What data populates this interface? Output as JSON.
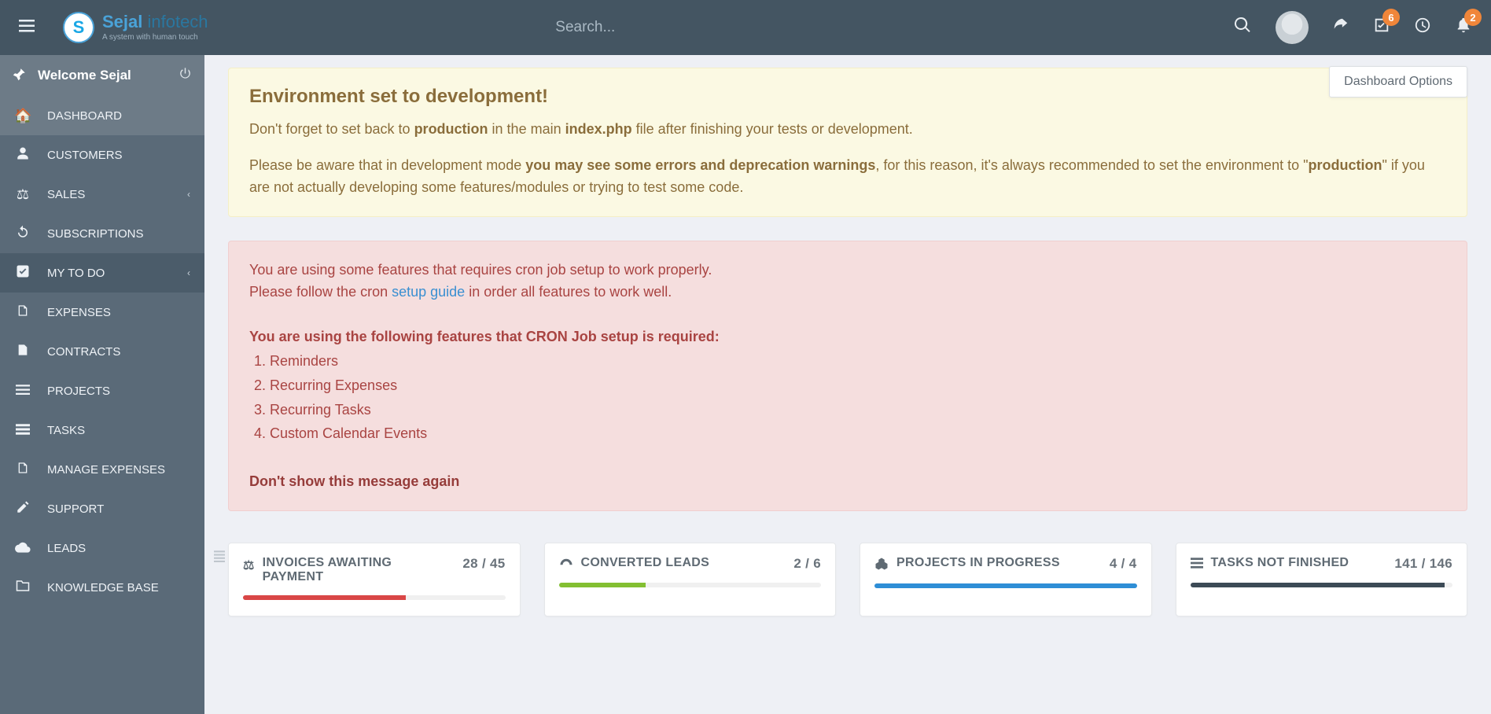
{
  "header": {
    "brand_main": "Sejal",
    "brand_secondary": " infotech",
    "brand_tagline": "A system with human touch",
    "search_placeholder": "Search...",
    "badge_tasks": "6",
    "badge_notifications": "2"
  },
  "welcome": {
    "text": "Welcome Sejal"
  },
  "sidebar": {
    "items": [
      {
        "label": "DASHBOARD",
        "icon": "🏠",
        "expandable": false
      },
      {
        "label": "CUSTOMERS",
        "icon": "👤",
        "expandable": false
      },
      {
        "label": "SALES",
        "icon": "⚖",
        "expandable": true
      },
      {
        "label": "SUBSCRIPTIONS",
        "icon": "↻",
        "expandable": false
      },
      {
        "label": "MY TO DO",
        "icon": "☑",
        "expandable": true
      },
      {
        "label": "EXPENSES",
        "icon": "📄",
        "expandable": false
      },
      {
        "label": "CONTRACTS",
        "icon": "📄",
        "expandable": false
      },
      {
        "label": "PROJECTS",
        "icon": "☰",
        "expandable": false
      },
      {
        "label": "TASKS",
        "icon": "☰",
        "expandable": false
      },
      {
        "label": "MANAGE EXPENSES",
        "icon": "📄",
        "expandable": false
      },
      {
        "label": "SUPPORT",
        "icon": "✎",
        "expandable": false
      },
      {
        "label": "LEADS",
        "icon": "☁",
        "expandable": false
      },
      {
        "label": "KNOWLEDGE BASE",
        "icon": "📂",
        "expandable": false
      }
    ]
  },
  "options_button": "Dashboard Options",
  "alerts": {
    "env": {
      "title": "Environment set to development!",
      "p1a": "Don't forget to set back to ",
      "p1b": "production",
      "p1c": " in the main ",
      "p1d": "index.php",
      "p1e": " file after finishing your tests or development.",
      "p2a": "Please be aware that in development mode ",
      "p2b": "you may see some errors and deprecation warnings",
      "p2c": ", for this reason, it's always recommended to set the environment to \"",
      "p2d": "production",
      "p2e": "\" if you are not actually developing some features/modules or trying to test some code."
    },
    "cron": {
      "line1": "You are using some features that requires cron job setup to work properly.",
      "line2a": "Please follow the cron ",
      "line2_link": "setup guide",
      "line2b": " in order all features to work well.",
      "req_heading": "You are using the following features that CRON Job setup is required:",
      "features": [
        "Reminders",
        "Recurring Expenses",
        "Recurring Tasks",
        "Custom Calendar Events"
      ],
      "dont_show": "Don't show this message again"
    }
  },
  "stats": [
    {
      "title": "INVOICES AWAITING PAYMENT",
      "count": "28 / 45",
      "color": "red",
      "pct": 62
    },
    {
      "title": "CONVERTED LEADS",
      "count": "2 / 6",
      "color": "green",
      "pct": 33
    },
    {
      "title": "PROJECTS IN PROGRESS",
      "count": "4 / 4",
      "color": "blue",
      "pct": 100
    },
    {
      "title": "TASKS NOT FINISHED",
      "count": "141 / 146",
      "color": "dark",
      "pct": 97
    }
  ]
}
